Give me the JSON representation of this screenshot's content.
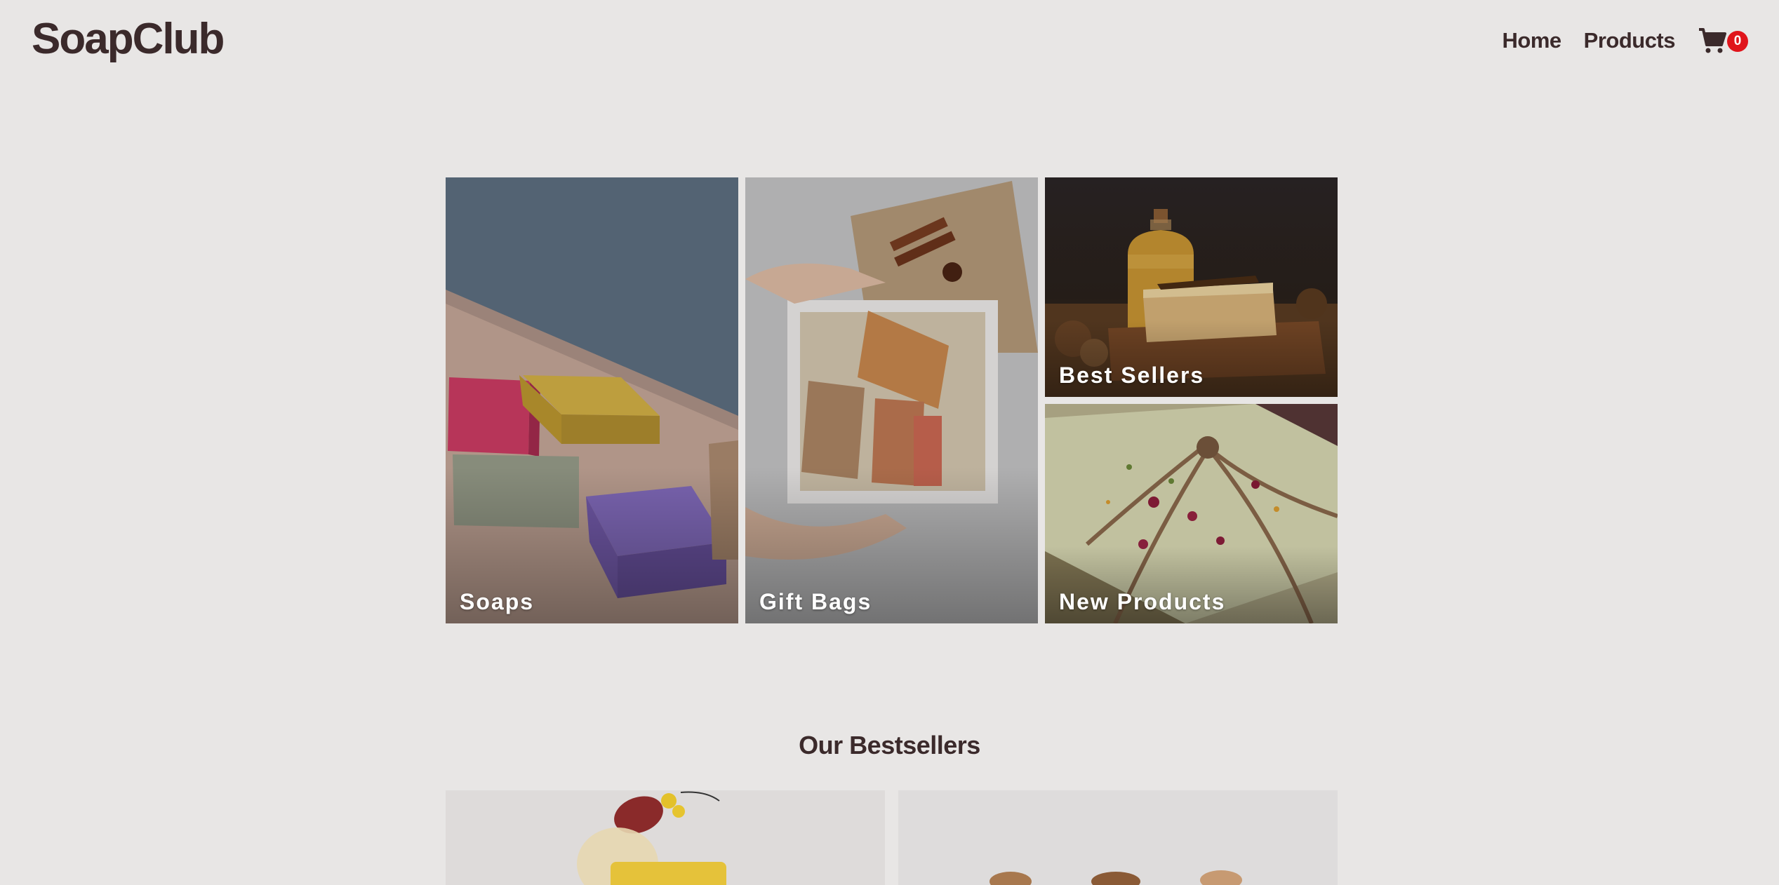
{
  "header": {
    "logo": "SoapClub",
    "nav": [
      {
        "label": "Home"
      },
      {
        "label": "Products"
      }
    ],
    "cart_count": "0"
  },
  "categories": [
    {
      "label": "Soaps"
    },
    {
      "label": "Gift Bags"
    },
    {
      "label": "Best Sellers"
    },
    {
      "label": "New Products"
    }
  ],
  "bestsellers": {
    "title": "Our Bestsellers"
  },
  "colors": {
    "background": "#e8e6e5",
    "text": "#3b2a2b",
    "badge": "#e0141b"
  }
}
